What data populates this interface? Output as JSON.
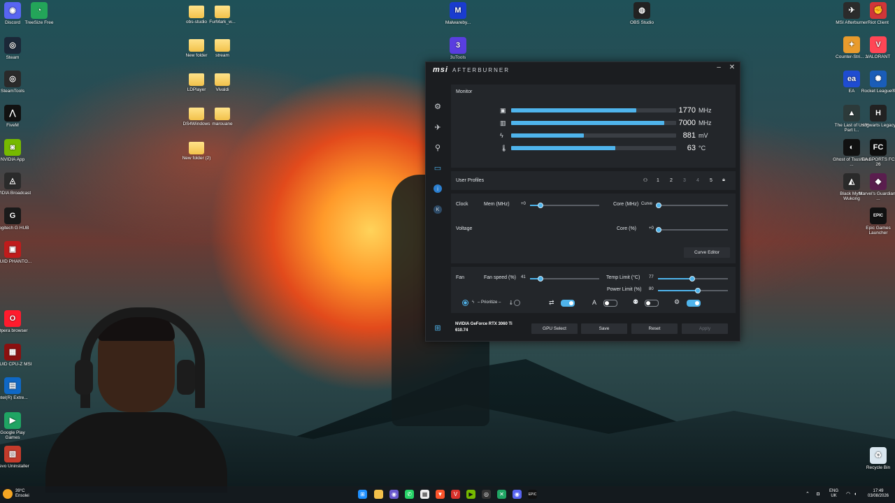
{
  "desktop": {
    "left_icons": [
      {
        "label": "Discord",
        "icon": "discord-icon",
        "color": "#5865f2",
        "glyph": "◉"
      },
      {
        "label": "TreeSize Free",
        "icon": "treesize-icon",
        "color": "#23a559",
        "glyph": "◔"
      },
      {
        "label": "Steam",
        "icon": "steam-icon",
        "color": "#1b2838",
        "glyph": "◎"
      },
      {
        "label": "SteamTools",
        "icon": "steamtools-icon",
        "color": "#2a2a2a",
        "glyph": "◎"
      },
      {
        "label": "FiveM",
        "icon": "fivem-icon",
        "color": "#111",
        "glyph": "⋀"
      },
      {
        "label": "NVIDIA App",
        "icon": "nvidia-icon",
        "color": "#76b900",
        "glyph": "◙"
      },
      {
        "label": "NVIDIA Broadcast",
        "icon": "nvidia-broadcast-icon",
        "color": "#2b2b2b",
        "glyph": "◬"
      },
      {
        "label": "Logitech G HUB",
        "icon": "logitech-icon",
        "color": "#1a1a1a",
        "glyph": "G"
      },
      {
        "label": "CPUID PHANTO...",
        "icon": "cpuid-phantom-icon",
        "color": "#c01b1b",
        "glyph": "▣"
      },
      {
        "label": "Opera browser",
        "icon": "opera-icon",
        "color": "#ff1b2d",
        "glyph": "O"
      },
      {
        "label": "CPUID CPU-Z MSI",
        "icon": "cpuz-icon",
        "color": "#8a1010",
        "glyph": "▦"
      },
      {
        "label": "Intel(R) Extre...",
        "icon": "intel-icon",
        "color": "#0f68c5",
        "glyph": "▤"
      },
      {
        "label": "Google Play Games",
        "icon": "google-play-games-icon",
        "color": "#1fa463",
        "glyph": "▶"
      },
      {
        "label": "Revo Uninstaller",
        "icon": "revo-icon",
        "color": "#c43b2b",
        "glyph": "▧"
      }
    ],
    "folders": [
      {
        "label": "obs-studio"
      },
      {
        "label": "FurMark_w..."
      },
      {
        "label": "New folder"
      },
      {
        "label": "stream"
      },
      {
        "label": "LDPlayer"
      },
      {
        "label": "Vivaldi"
      },
      {
        "label": "DS4Windows"
      },
      {
        "label": "marouane"
      },
      {
        "label": "New folder (2)"
      }
    ],
    "mid_icons": [
      {
        "label": "Malwareby...",
        "icon": "malwarebytes-icon",
        "color": "#1a3ccf",
        "glyph": "M"
      },
      {
        "label": "3uTools",
        "icon": "3utools-icon",
        "color": "#5a3ee0",
        "glyph": "3"
      },
      {
        "label": "OBS Studio",
        "icon": "obs-icon",
        "color": "#222",
        "glyph": "◍"
      }
    ],
    "right_icons": [
      {
        "label": "MSI Afterburner",
        "icon": "msi-afterburner-icon",
        "color": "#2b2b2b",
        "glyph": "✈"
      },
      {
        "label": "Riot Client",
        "icon": "riot-icon",
        "color": "#d13639",
        "glyph": "✊"
      },
      {
        "label": "Counter-Stri... 2",
        "icon": "cs2-icon",
        "color": "#e99b2c",
        "glyph": "✦"
      },
      {
        "label": "VALORANT",
        "icon": "valorant-icon",
        "color": "#ff4655",
        "glyph": "V"
      },
      {
        "label": "EA",
        "icon": "ea-icon",
        "color": "#1f4cd1",
        "glyph": "ea"
      },
      {
        "label": "Rocket League®",
        "icon": "rocket-league-icon",
        "color": "#1a5db8",
        "glyph": "✺"
      },
      {
        "label": "The Last of Us™ Part I...",
        "icon": "tlou-icon",
        "color": "#2c3a3a",
        "glyph": "▲"
      },
      {
        "label": "Hogwarts Legacy",
        "icon": "hogwarts-icon",
        "color": "#222",
        "glyph": "H"
      },
      {
        "label": "Ghost of Tsushima ...",
        "icon": "ghost-of-tsushima-icon",
        "color": "#111",
        "glyph": "◐"
      },
      {
        "label": "EA SPORTS FC 26",
        "icon": "ea-fc-icon",
        "color": "#0d0d0d",
        "glyph": "FC"
      },
      {
        "label": "Black Myth: Wukong",
        "icon": "black-myth-icon",
        "color": "#2a2a2a",
        "glyph": "◭"
      },
      {
        "label": "Marvel's Guardians ...",
        "icon": "guardians-icon",
        "color": "#5a1e4e",
        "glyph": "◆"
      },
      {
        "label": "Epic Games Launcher",
        "icon": "epic-games-icon",
        "color": "#111",
        "glyph": "EPIC"
      },
      {
        "label": "Recycle Bin",
        "icon": "recycle-bin-icon",
        "color": "#d9e6ef",
        "glyph": "♻"
      }
    ]
  },
  "msi": {
    "brand": "msi",
    "app_title": "AFTERBURNER",
    "monitor": {
      "title": "Monitor",
      "rows": [
        {
          "icon": "gpu-chip-icon",
          "value": "1770",
          "unit": "MHz",
          "fill": 0.76
        },
        {
          "icon": "memory-icon",
          "value": "7000",
          "unit": "MHz",
          "fill": 0.93
        },
        {
          "icon": "voltage-icon",
          "value": "881",
          "unit": "mV",
          "fill": 0.44
        },
        {
          "icon": "temperature-icon",
          "value": "63",
          "unit": "°C",
          "fill": 0.63
        }
      ]
    },
    "profiles": {
      "title": "User Profiles",
      "slots": [
        "1",
        "2",
        "3",
        "4",
        "5"
      ]
    },
    "clock": {
      "title": "Clock",
      "mem_label": "Mem (MHz)",
      "mem_value": "+0",
      "core_label": "Core (MHz)",
      "core_value": "Curve"
    },
    "voltage": {
      "title": "Voltage",
      "core_label": "Core (%)",
      "core_value": "+0",
      "curve_editor": "Curve Editor"
    },
    "fan": {
      "title": "Fan",
      "speed_label": "Fan speed (%)",
      "speed_value": "41",
      "temp_label": "Temp Limit (°C)",
      "temp_value": "77",
      "power_label": "Power Limit (%)",
      "power_value": "80",
      "prioritize": "Prioritize"
    },
    "footer": {
      "gpu_name": "NVIDIA GeForce RTX 3060 Ti",
      "driver": "610.74",
      "gpu_select": "GPU Select",
      "save": "Save",
      "reset": "Reset",
      "apply": "Apply"
    }
  },
  "taskbar": {
    "weather_temp": "39°C",
    "weather_desc": "Ensolei",
    "lang": "ENG",
    "region": "UK",
    "time": "17:49",
    "date": "03/08/2026"
  }
}
